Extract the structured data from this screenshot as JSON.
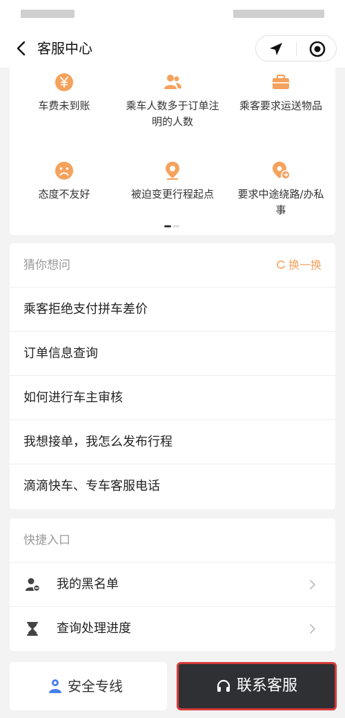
{
  "nav": {
    "title": "客服中心",
    "back_icon": "chevron-left-icon",
    "location_icon": "navigation-arrow-icon",
    "target_icon": "target-circle-icon"
  },
  "categories": [
    {
      "label": "车费未到账",
      "icon": "yen-coin-icon"
    },
    {
      "label": "乘车人数多于订单注明的人数",
      "icon": "people-icon"
    },
    {
      "label": "乘客要求运送物品",
      "icon": "briefcase-icon"
    },
    {
      "label": "态度不友好",
      "icon": "sad-face-icon"
    },
    {
      "label": "被迫变更行程起点",
      "icon": "location-pin-icon"
    },
    {
      "label": "要求中途绕路/办私事",
      "icon": "pin-detour-icon"
    }
  ],
  "guess": {
    "title": "猜你想问",
    "refresh_label": "换一换",
    "questions": [
      "乘客拒绝支付拼车差价",
      "订单信息查询",
      "如何进行车主审核",
      "我想接单，我怎么发布行程",
      "滴滴快车、专车客服电话"
    ]
  },
  "quick": {
    "title": "快捷入口",
    "items": [
      {
        "label": "我的黑名单",
        "icon": "blocked-user-icon"
      },
      {
        "label": "查询处理进度",
        "icon": "hourglass-icon"
      }
    ]
  },
  "bottom": {
    "safety_label": "安全专线",
    "contact_label": "联系客服"
  },
  "colors": {
    "accent_orange": "#f5a25d",
    "dark_button": "#2e3034",
    "highlight_border": "#d83a3a",
    "safety_blue": "#4a7ff0"
  }
}
